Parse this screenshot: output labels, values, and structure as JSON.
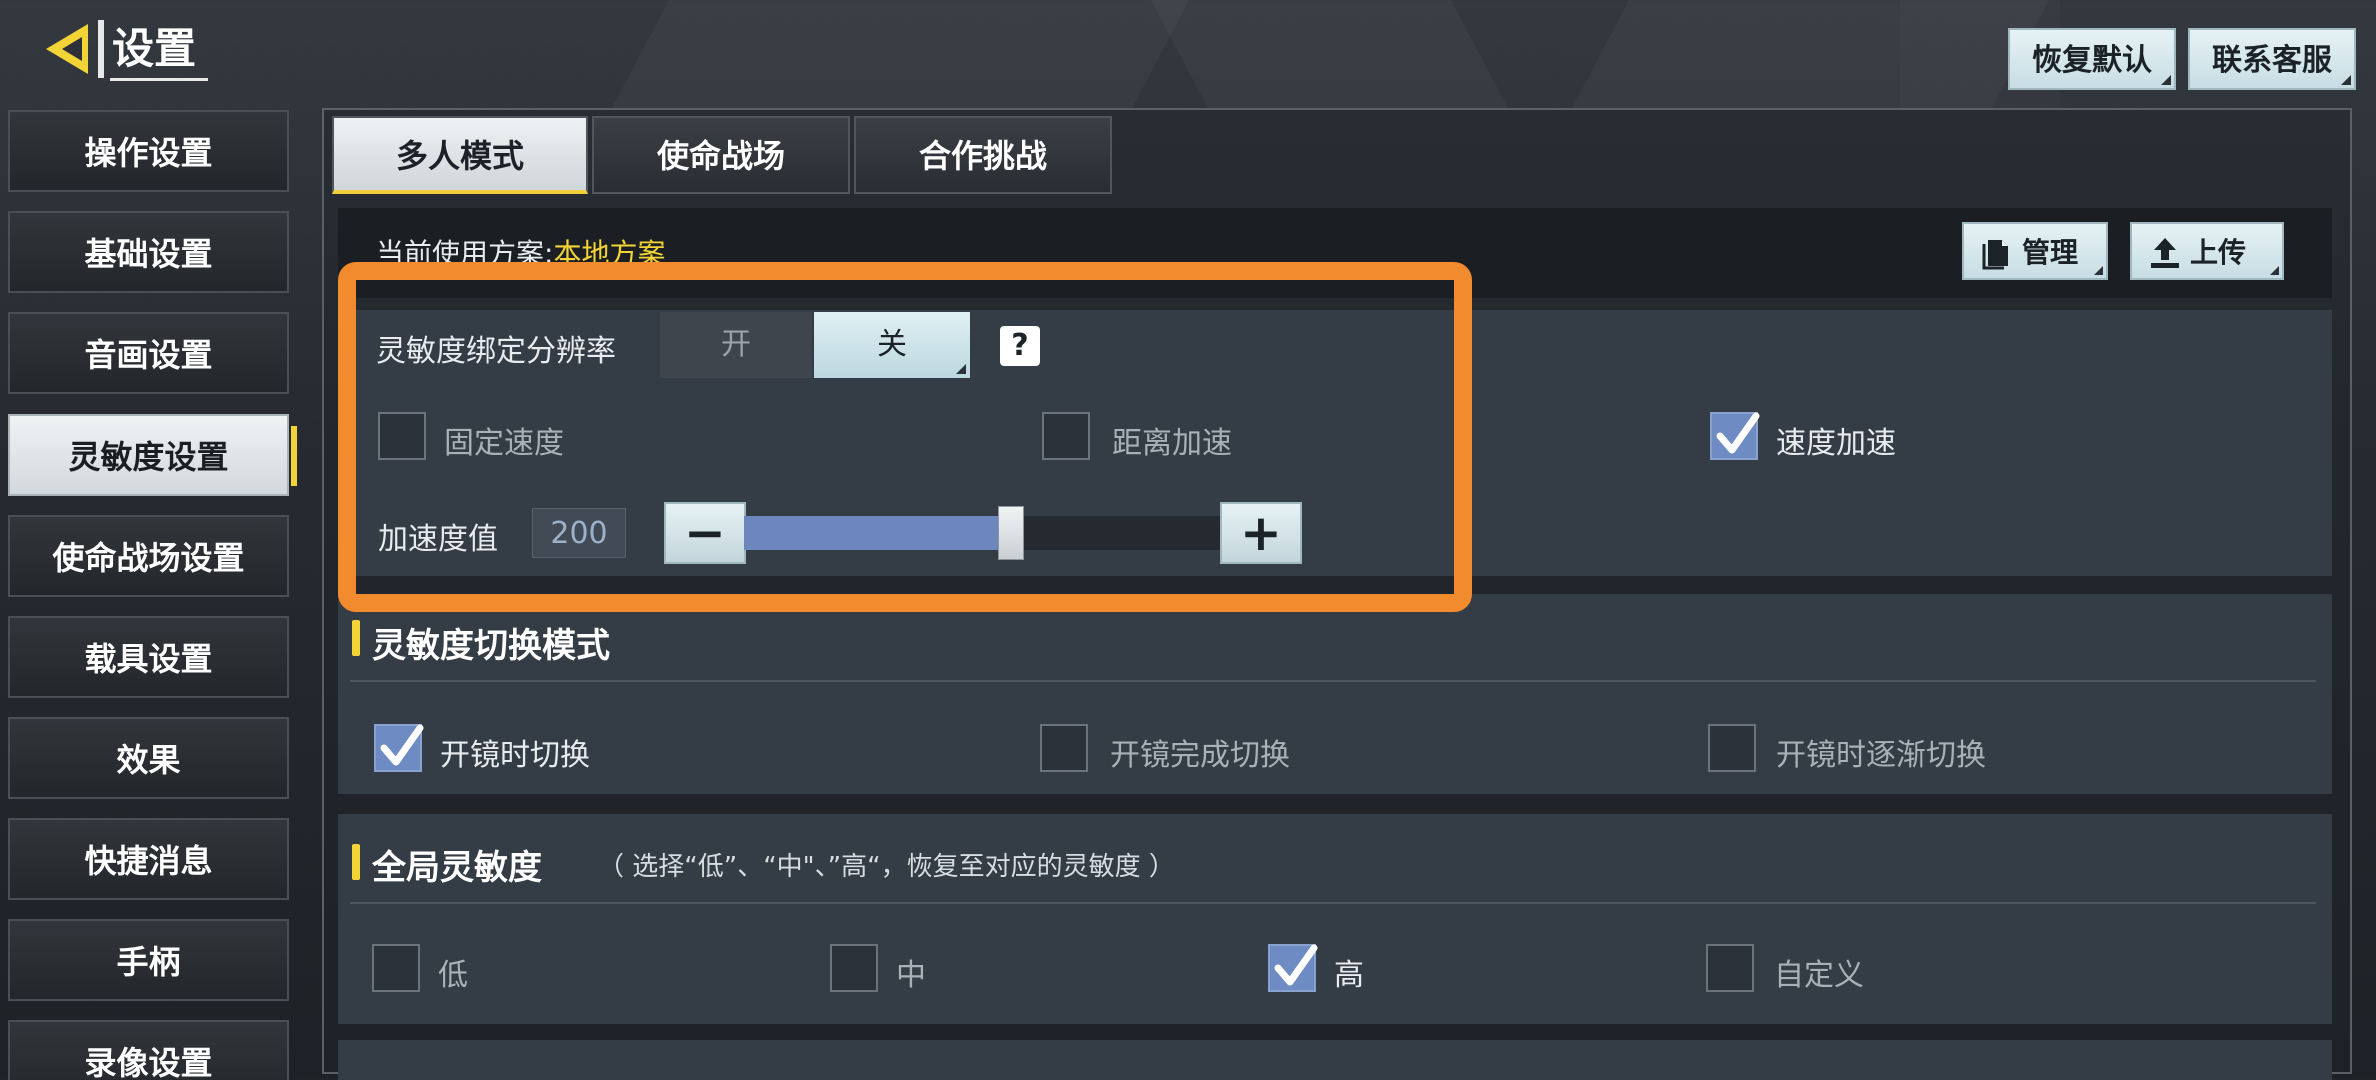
{
  "header": {
    "title": "设置",
    "restore_default": "恢复默认",
    "contact_service": "联系客服"
  },
  "sidebar": {
    "items": [
      {
        "label": "操作设置"
      },
      {
        "label": "基础设置"
      },
      {
        "label": "音画设置"
      },
      {
        "label": "灵敏度设置",
        "active": true
      },
      {
        "label": "使命战场设置"
      },
      {
        "label": "载具设置"
      },
      {
        "label": "效果"
      },
      {
        "label": "快捷消息"
      },
      {
        "label": "手柄"
      },
      {
        "label": "录像设置"
      }
    ]
  },
  "tabs": [
    {
      "label": "多人模式",
      "active": true
    },
    {
      "label": "使命战场"
    },
    {
      "label": "合作挑战"
    }
  ],
  "scheme": {
    "label": "当前使用方案:",
    "value": "本地方案",
    "manage": "管理",
    "upload": "上传"
  },
  "sensitivity_binding": {
    "label": "灵敏度绑定分辨率",
    "on": "开",
    "off": "关",
    "selected": "关",
    "help": "?"
  },
  "speed_options": [
    {
      "label": "固定速度",
      "checked": false
    },
    {
      "label": "距离加速",
      "checked": false
    },
    {
      "label": "速度加速",
      "checked": true
    }
  ],
  "acceleration": {
    "label": "加速度值",
    "value": "200",
    "minus": "−",
    "plus": "+",
    "level": 0.56
  },
  "switch_mode": {
    "title": "灵敏度切换模式",
    "options": [
      {
        "label": "开镜时切换",
        "checked": true
      },
      {
        "label": "开镜完成切换",
        "checked": false
      },
      {
        "label": "开镜时逐渐切换",
        "checked": false
      }
    ]
  },
  "global_sensitivity": {
    "title": "全局灵敏度",
    "note": "（ 选择“低”、“中\"、”高“，恢复至对应的灵敏度 ）",
    "options": [
      {
        "label": "低",
        "checked": false
      },
      {
        "label": "中",
        "checked": false
      },
      {
        "label": "高",
        "checked": true
      },
      {
        "label": "自定义",
        "checked": false
      }
    ]
  },
  "colors": {
    "accent_yellow": "#f3d437",
    "highlight_orange": "#f28a2e",
    "checkbox_on": "#6f8bc4"
  }
}
